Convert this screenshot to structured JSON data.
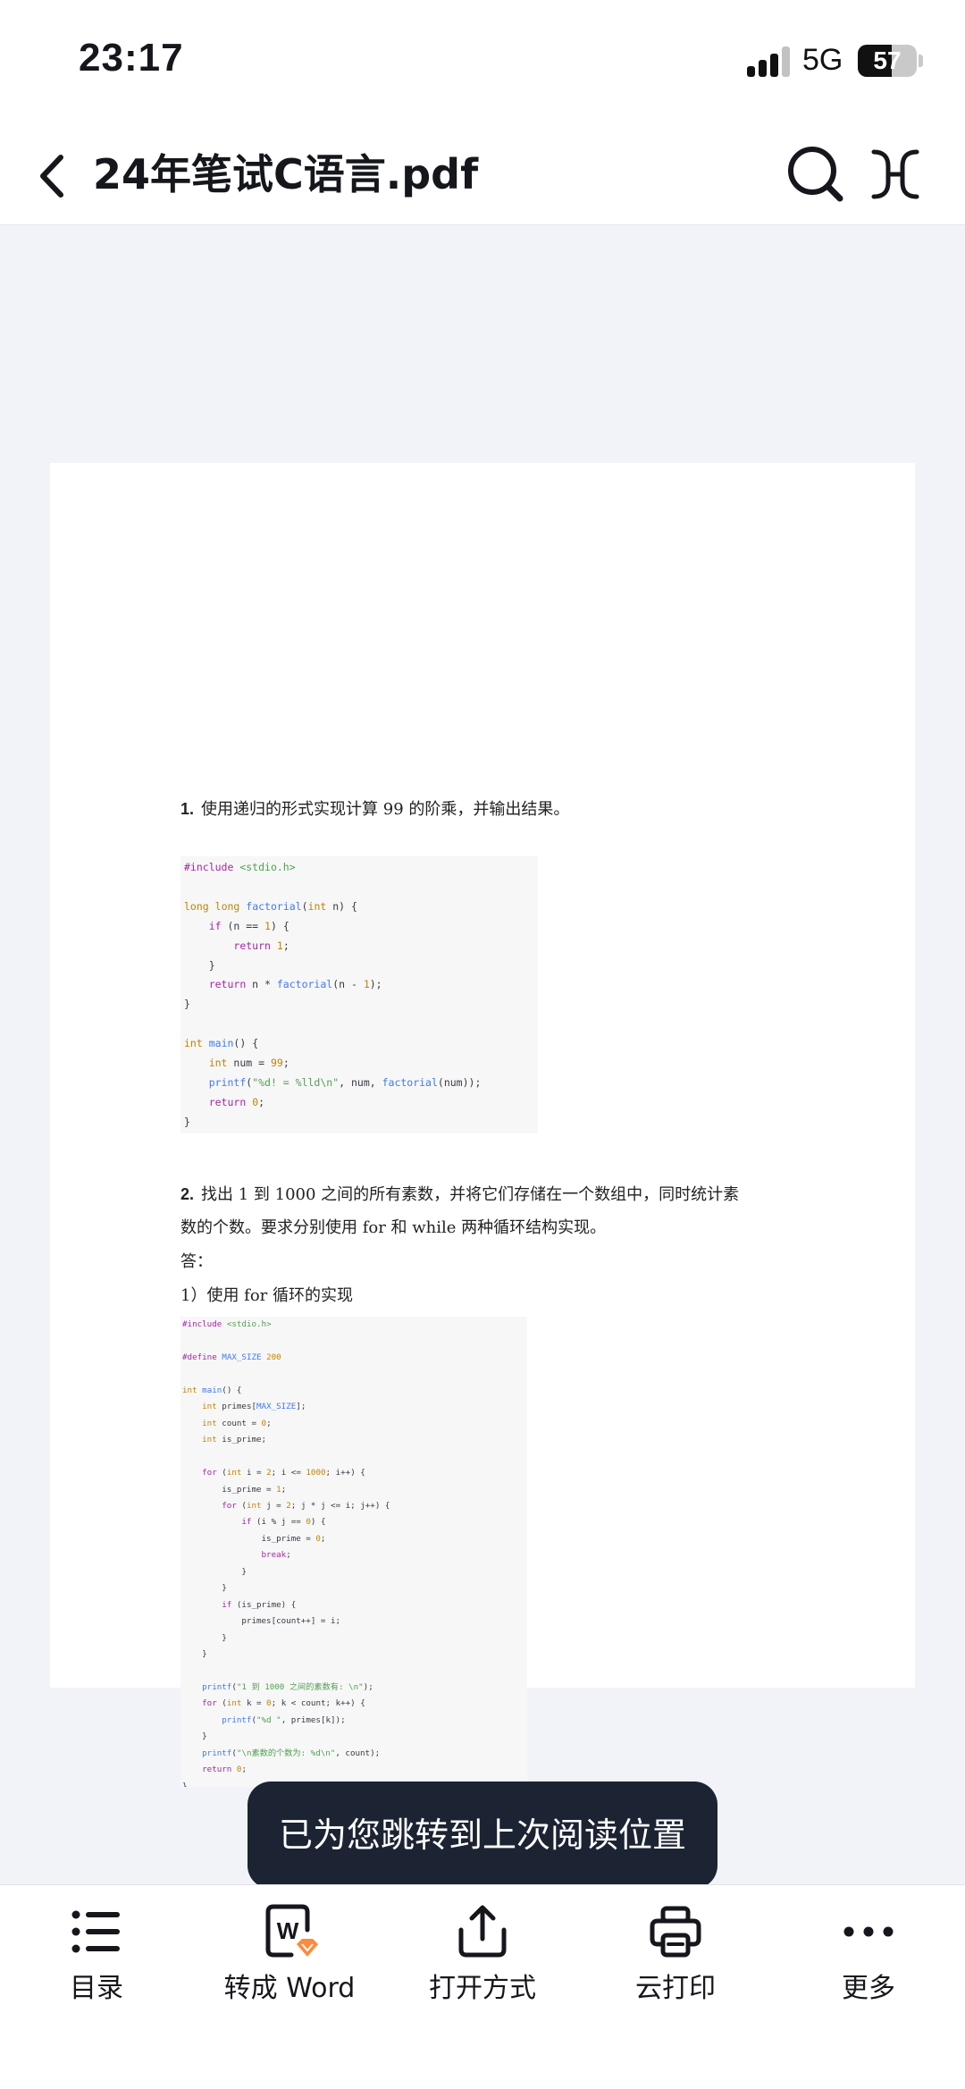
{
  "status_bar": {
    "time": "23:17",
    "network": "5G",
    "battery": "57",
    "battery_level": 0.57
  },
  "nav": {
    "title": "24年笔试C语言.pdf"
  },
  "document": {
    "q1": {
      "number": "1.",
      "text": "使用递归的形式实现计算 99 的阶乘，并输出结果。"
    },
    "code1": [
      "#include <stdio.h>",
      "",
      "long long factorial(int n) {",
      "    if (n == 1) {",
      "        return 1;",
      "    }",
      "    return n * factorial(n - 1);",
      "}",
      "",
      "int main() {",
      "    int num = 99;",
      "    printf(\"%d! = %lld\\n\", num, factorial(num));",
      "    return 0;",
      "}"
    ],
    "q2": {
      "number": "2.",
      "line1": "找出 1 到 1000 之间的所有素数，并将它们存储在一个数组中，同时统计素",
      "line2": "数的个数。要求分别使用 for 和 while 两种循环结构实现。",
      "answer_label": "答：",
      "sub_label": "1）使用 for 循环的实现"
    },
    "code2": [
      "#include <stdio.h>",
      "",
      "#define MAX_SIZE 200",
      "",
      "int main() {",
      "    int primes[MAX_SIZE];",
      "    int count = 0;",
      "    int is_prime;",
      "",
      "    for (int i = 2; i <= 1000; i++) {",
      "        is_prime = 1;",
      "        for (int j = 2; j * j <= i; j++) {",
      "            if (i % j == 0) {",
      "                is_prime = 0;",
      "                break;",
      "            }",
      "        }",
      "        if (is_prime) {",
      "            primes[count++] = i;",
      "        }",
      "    }",
      "",
      "    printf(\"1 到 1000 之间的素数有: \\n\");",
      "    for (int k = 0; k < count; k++) {",
      "        printf(\"%d \", primes[k]);",
      "    }",
      "    printf(\"\\n素数的个数为: %d\\n\", count);",
      "    return 0;",
      "}"
    ]
  },
  "toast": {
    "text": "已为您跳转到上次阅读位置"
  },
  "toolbar": {
    "items": [
      {
        "label": "目录",
        "icon": "list-icon"
      },
      {
        "label": "转成 Word",
        "icon": "word-convert-icon"
      },
      {
        "label": "打开方式",
        "icon": "share-icon"
      },
      {
        "label": "云打印",
        "icon": "printer-icon"
      },
      {
        "label": "更多",
        "icon": "more-icon"
      }
    ]
  },
  "colors": {
    "accent": "#ff8a3d",
    "toast_bg": "#1c2433",
    "code_keyword": "#a626a4",
    "code_function": "#4078f2",
    "code_number": "#c18401",
    "code_string": "#50a14f"
  }
}
